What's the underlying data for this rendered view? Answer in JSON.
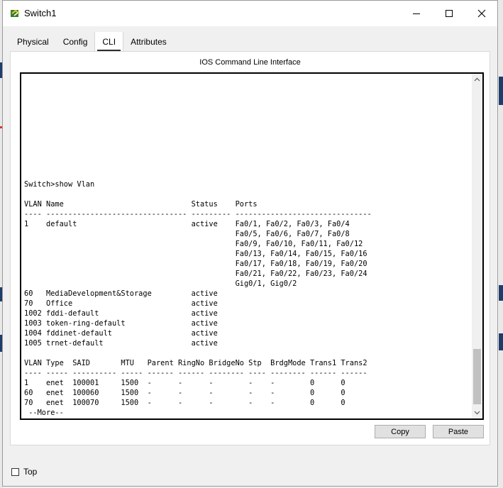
{
  "window": {
    "title": "Switch1",
    "controls": {
      "minimize_icon": "minimize-icon",
      "maximize_icon": "maximize-icon",
      "close_icon": "close-icon"
    }
  },
  "tabs": [
    {
      "label": "Physical",
      "active": false
    },
    {
      "label": "Config",
      "active": false
    },
    {
      "label": "CLI",
      "active": true
    },
    {
      "label": "Attributes",
      "active": false
    }
  ],
  "panel": {
    "title": "IOS Command Line Interface"
  },
  "terminal": {
    "lines": [
      "Switch>show Vlan",
      "",
      "VLAN Name                             Status    Ports",
      "---- -------------------------------- --------- -------------------------------",
      "1    default                          active    Fa0/1, Fa0/2, Fa0/3, Fa0/4",
      "                                                Fa0/5, Fa0/6, Fa0/7, Fa0/8",
      "                                                Fa0/9, Fa0/10, Fa0/11, Fa0/12",
      "                                                Fa0/13, Fa0/14, Fa0/15, Fa0/16",
      "                                                Fa0/17, Fa0/18, Fa0/19, Fa0/20",
      "                                                Fa0/21, Fa0/22, Fa0/23, Fa0/24",
      "                                                Gig0/1, Gig0/2",
      "60   MediaDevelopment&Storage         active",
      "70   Office                           active",
      "1002 fddi-default                     active",
      "1003 token-ring-default               active",
      "1004 fddinet-default                  active",
      "1005 trnet-default                    active",
      "",
      "VLAN Type  SAID       MTU   Parent RingNo BridgeNo Stp  BrdgMode Trans1 Trans2",
      "---- ----- ---------- ----- ------ ------ -------- ---- -------- ------ ------",
      "1    enet  100001     1500  -      -      -        -    -        0      0",
      "60   enet  100060     1500  -      -      -        -    -        0      0",
      "70   enet  100070     1500  -      -      -        -    -        0      0",
      " --More--"
    ]
  },
  "buttons": {
    "copy": "Copy",
    "paste": "Paste"
  },
  "footer": {
    "top_label": "Top",
    "top_checked": false
  }
}
